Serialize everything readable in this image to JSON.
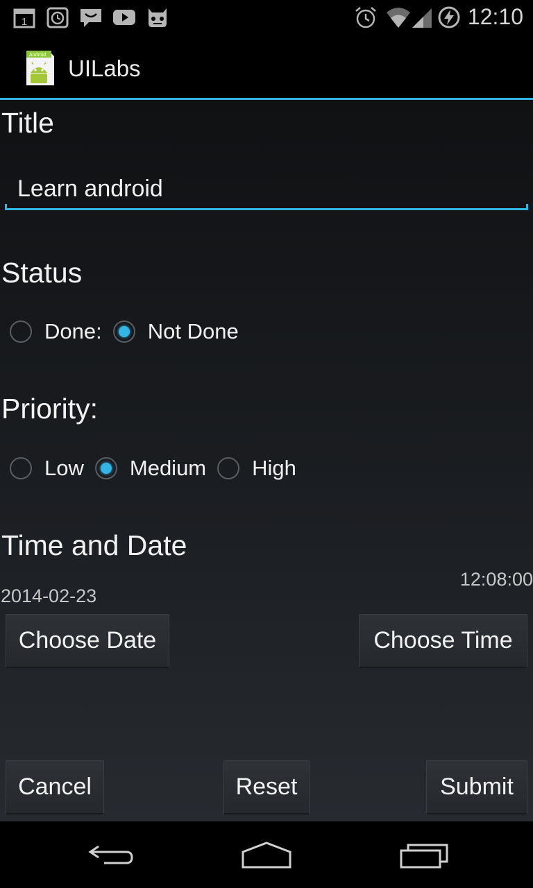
{
  "status_bar": {
    "time": "12:10",
    "icons": [
      "calendar-icon",
      "alarm-clock-icon",
      "message-icon",
      "youtube-icon",
      "cyanogen-icon"
    ],
    "right_icons": [
      "alarm-icon",
      "wifi-icon",
      "signal-icon",
      "battery-charging-icon"
    ],
    "calendar_day": "1"
  },
  "action_bar": {
    "title": "UILabs",
    "icon": "android-app-icon",
    "icon_caption": "Android"
  },
  "form": {
    "title_label": "Title",
    "title_value": "Learn android",
    "status_label": "Status",
    "status_options": [
      {
        "label": "Done:",
        "checked": false
      },
      {
        "label": "Not Done",
        "checked": true
      }
    ],
    "priority_label": "Priority:",
    "priority_options": [
      {
        "label": "Low",
        "checked": false
      },
      {
        "label": "Medium",
        "checked": true
      },
      {
        "label": "High",
        "checked": false
      }
    ],
    "time_date_label": "Time and Date",
    "time_value": "12:08:00",
    "date_value": "2014-02-23",
    "choose_date_label": "Choose Date",
    "choose_time_label": "Choose Time"
  },
  "footer": {
    "cancel_label": "Cancel",
    "reset_label": "Reset",
    "submit_label": "Submit"
  },
  "nav_bar": {
    "icons": [
      "back-icon",
      "home-icon",
      "recents-icon"
    ]
  },
  "colors": {
    "accent": "#33b5e5",
    "background": "#000000"
  }
}
